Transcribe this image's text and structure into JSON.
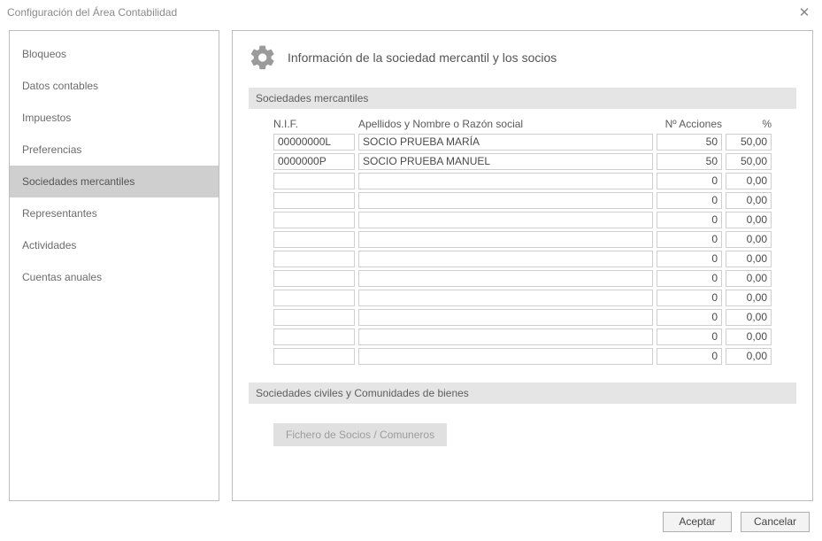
{
  "window": {
    "title": "Configuración del Área Contabilidad"
  },
  "sidebar": {
    "items": [
      {
        "label": "Bloqueos"
      },
      {
        "label": "Datos contables"
      },
      {
        "label": "Impuestos"
      },
      {
        "label": "Preferencias"
      },
      {
        "label": "Sociedades mercantiles"
      },
      {
        "label": "Representantes"
      },
      {
        "label": "Actividades"
      },
      {
        "label": "Cuentas anuales"
      }
    ],
    "selected_index": 4
  },
  "main": {
    "heading": "Información de la sociedad mercantil y los socios",
    "section1_title": "Sociedades mercantiles",
    "columns": {
      "nif": "N.I.F.",
      "name": "Apellidos y Nombre o Razón social",
      "acciones": "Nº Acciones",
      "pct": "%"
    },
    "rows": [
      {
        "nif": "00000000L",
        "name": "SOCIO PRUEBA MARÍA",
        "acciones": "50",
        "pct": "50,00"
      },
      {
        "nif": "0000000P",
        "name": "SOCIO PRUEBA MANUEL",
        "acciones": "50",
        "pct": "50,00"
      },
      {
        "nif": "",
        "name": "",
        "acciones": "0",
        "pct": "0,00"
      },
      {
        "nif": "",
        "name": "",
        "acciones": "0",
        "pct": "0,00"
      },
      {
        "nif": "",
        "name": "",
        "acciones": "0",
        "pct": "0,00"
      },
      {
        "nif": "",
        "name": "",
        "acciones": "0",
        "pct": "0,00"
      },
      {
        "nif": "",
        "name": "",
        "acciones": "0",
        "pct": "0,00"
      },
      {
        "nif": "",
        "name": "",
        "acciones": "0",
        "pct": "0,00"
      },
      {
        "nif": "",
        "name": "",
        "acciones": "0",
        "pct": "0,00"
      },
      {
        "nif": "",
        "name": "",
        "acciones": "0",
        "pct": "0,00"
      },
      {
        "nif": "",
        "name": "",
        "acciones": "0",
        "pct": "0,00"
      },
      {
        "nif": "",
        "name": "",
        "acciones": "0",
        "pct": "0,00"
      }
    ],
    "section2_title": "Sociedades civiles y Comunidades de bienes",
    "fichero_button": "Fichero de Socios / Comuneros"
  },
  "footer": {
    "ok": "Aceptar",
    "cancel": "Cancelar"
  }
}
